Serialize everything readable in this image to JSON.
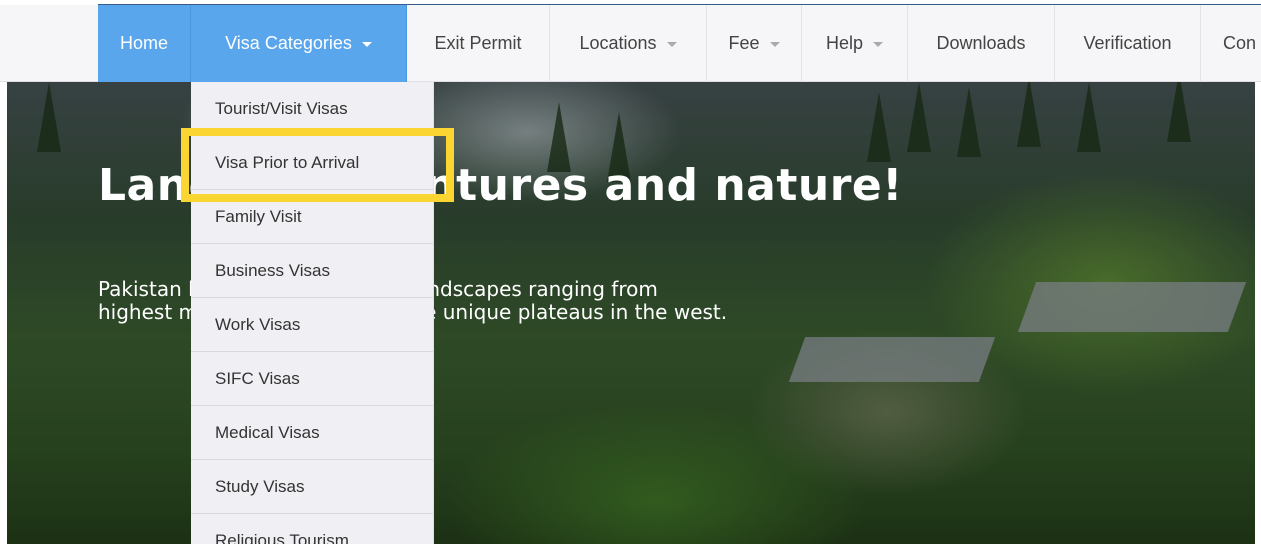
{
  "nav": {
    "items": [
      {
        "label": "Home",
        "active": true,
        "caret": false
      },
      {
        "label": "Visa Categories",
        "active": true,
        "caret": true
      },
      {
        "label": "Exit Permit",
        "active": false,
        "caret": false
      },
      {
        "label": "Locations",
        "active": false,
        "caret": true
      },
      {
        "label": "Fee",
        "active": false,
        "caret": true
      },
      {
        "label": "Help",
        "active": false,
        "caret": true
      },
      {
        "label": "Downloads",
        "active": false,
        "caret": false
      },
      {
        "label": "Verification",
        "active": false,
        "caret": false
      },
      {
        "label": "Con",
        "active": false,
        "caret": false
      }
    ]
  },
  "dropdown": {
    "items": [
      "Tourist/Visit Visas",
      "Visa Prior to Arrival",
      "Family Visit",
      "Business Visas",
      "Work Visas",
      "SIFC Visas",
      "Medical Visas",
      "Study Visas",
      "Religious Tourism"
    ],
    "highlighted_index": 1
  },
  "hero": {
    "headline": "Land of adventures and nature!",
    "subtext_line1": "Pakistan has a great variety of landscapes ranging from",
    "subtext_line2": "highest mountains to some of the unique plateaus in the west."
  },
  "colors": {
    "accent": "#5aa6ec",
    "highlight": "#fbd531"
  }
}
